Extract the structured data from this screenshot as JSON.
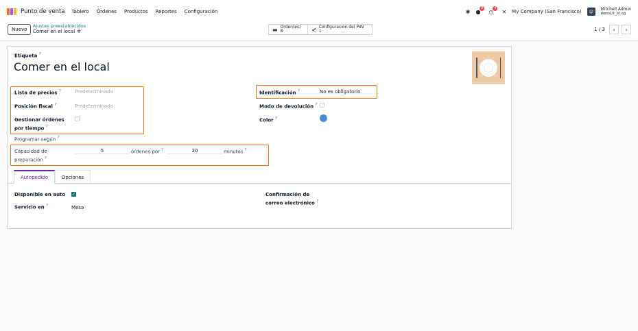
{
  "navbar": {
    "app_name": "Punto de venta",
    "menu": [
      "Tablero",
      "Órdenes",
      "Productos",
      "Reportes",
      "Configuración"
    ],
    "badges": {
      "messages": "8",
      "activities": "4"
    },
    "company": "My Company (San Francisco)",
    "user_name": "Mitchell Admin",
    "user_db": "demo19_blog"
  },
  "control": {
    "new_label": "Nuevo",
    "breadcrumb_parent": "Ajustes preestablecidos",
    "breadcrumb_current": "Comer en el local",
    "smart_orders_label": "Orden(es)",
    "smart_orders_count": "8",
    "smart_config_label": "Configuración del PdV",
    "smart_config_count": "1",
    "pager": "1 / 3"
  },
  "form": {
    "label_title": "Etiqueta",
    "title": "Comer en el local",
    "pricelist_label": "Lista de precios",
    "pricelist_placeholder": "Predeterminado",
    "fiscal_label": "Posición fiscal",
    "fiscal_placeholder": "Predeterminado",
    "timed_label_1": "Gestionar órdenes",
    "timed_label_2": "por tiempo",
    "schedule_label": "Programar según",
    "capacity_label_1": "Capacidad de",
    "capacity_label_2": "preparación",
    "capacity_value": "5",
    "orders_per_label": "órdenes por",
    "minutes_value": "20",
    "minutes_label": "minutos",
    "identification_label": "Identificación",
    "identification_value": "No es obligatorio",
    "return_label": "Modo de devolución",
    "color_label": "Color",
    "color_value": "#4a8bd6"
  },
  "tabs": [
    "Autopedido",
    "Opciones"
  ],
  "tab_content": {
    "auto_label": "Disponible en auto",
    "service_label": "Servicio en",
    "service_value": "Mesa",
    "email_conf_label_1": "Confirmación de",
    "email_conf_label_2": "correo electrónico"
  },
  "colors": {
    "accent": "#6b21a8",
    "primary": "#0f766e",
    "highlight": "#f97316"
  }
}
